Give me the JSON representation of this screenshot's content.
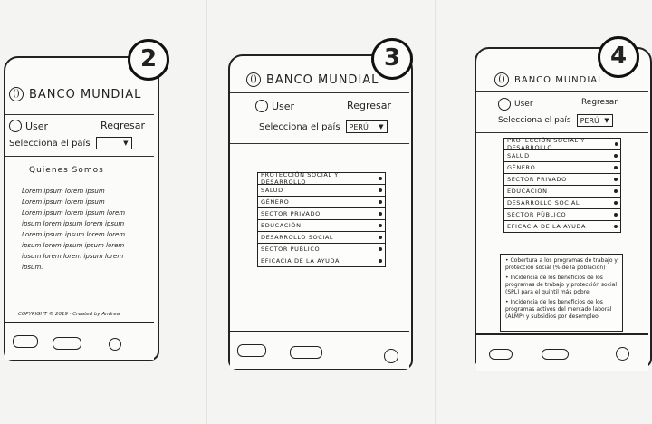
{
  "brand": "BANCO MUNDIAL",
  "user": "User",
  "back": "Regresar",
  "select_label": "Selecciona el país",
  "screen2": {
    "number": "2",
    "section_title": "Quienes Somos",
    "lorem_lines": [
      "Lorem ipsum lorem ipsum",
      "Lorem ipsum lorem ipsum",
      "Lorem ipsum lorem ipsum lorem",
      "ipsum lorem ipsum lorem ipsum",
      "Lorem ipsum ipsum lorem lorem",
      "ipsum lorem ipsum ipsum lorem",
      "ipsum lorem lorem ipsum lorem",
      "ipsum."
    ],
    "footer": "COPYRIGHT © 2019 · Created by Andrea"
  },
  "screen3": {
    "number": "3",
    "selected_country": "PERÚ",
    "menu": [
      "Protección social y desarrollo",
      "Salud",
      "Género",
      "Sector privado",
      "Educación",
      "Desarrollo social",
      "Sector público",
      "Eficacia de la ayuda"
    ]
  },
  "screen4": {
    "number": "4",
    "selected_country": "PERÚ",
    "menu": [
      "Protección social y desarrollo",
      "Salud",
      "Género",
      "Sector privado",
      "Educación",
      "Desarrollo social",
      "Sector público",
      "Eficacia de la ayuda"
    ],
    "bullets": [
      "Cobertura a los programas de trabajo y protección social (% de la población)",
      "Incidencia de los beneficios de los programas de trabajo y protección social (SPL) para el quintil más pobre.",
      "Incidencia de los beneficios de los programas activos del mercado laboral (ALMP) y subsidios por desempleo."
    ]
  }
}
